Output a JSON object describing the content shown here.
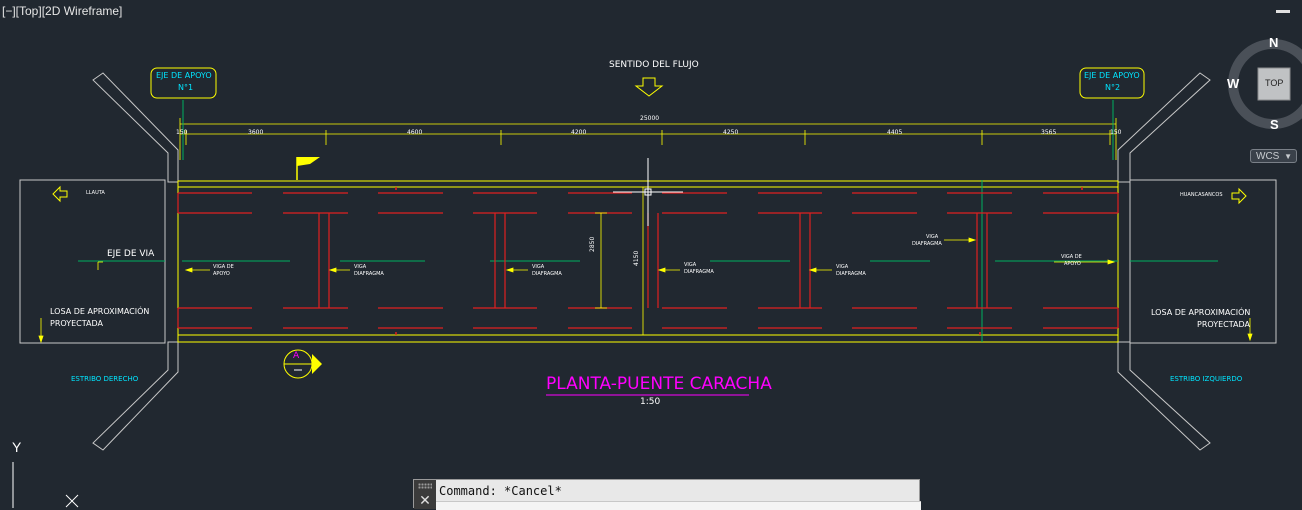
{
  "viewport": {
    "label": "[−][Top][2D Wireframe]"
  },
  "viewcube": {
    "north": "N",
    "south": "S",
    "west": "W",
    "face": "TOP",
    "wcs": "WCS"
  },
  "drawing": {
    "flow_label": "SENTIDO DEL FLUJO",
    "axis_1": {
      "line1": "EJE DE APOYO",
      "line2": "N°1"
    },
    "axis_2": {
      "line1": "EJE DE APOYO",
      "line2": "N°2"
    },
    "total_dim": "25000",
    "dims": [
      "150",
      "3600",
      "4600",
      "4200",
      "4250",
      "4405",
      "3565",
      "150"
    ],
    "left_city": "LLAUTA",
    "right_city": "HUANCASANCOS",
    "eje_via": "EJE DE VIA",
    "losa_left": {
      "line1": "LOSA DE APROXIMACIÓN",
      "line2": "PROYECTADA"
    },
    "losa_right": {
      "line1": "LOSA DE APROXIMACIÓN",
      "line2": "PROYECTADA"
    },
    "estribo_left": "ESTRIBO DERECHO",
    "estribo_right": "ESTRIBO IZQUIERDO",
    "viga_apoyo_1": {
      "line1": "VIGA DE",
      "line2": "APOYO"
    },
    "viga_apoyo_2": {
      "line1": "VIGA DE",
      "line2": "APOYO"
    },
    "diaf_1": {
      "line1": "VIGA",
      "line2": "DIAFRAGMA"
    },
    "diaf_2": {
      "line1": "VIGA",
      "line2": "DIAFRAGMA"
    },
    "diaf_3": {
      "line1": "VIGA",
      "line2": "DIAFRAGMA"
    },
    "diaf_4": {
      "line1": "VIGA",
      "line2": "DIAFRAGMA"
    },
    "diaf_5": {
      "line1": "VIGA",
      "line2": "DIAFRAGMA"
    },
    "dim_v1": "2850",
    "dim_v2": "4150",
    "section_mark": "A",
    "title": "PLANTA-PUENTE CARACHA",
    "scale": "1:50"
  },
  "ucs": {
    "y": "Y"
  },
  "command": {
    "text": "Command: *Cancel*"
  },
  "colors": {
    "background": "#212830",
    "yellow": "#ffff00",
    "red": "#e02020",
    "green": "#00b060",
    "cyan": "#00e5ff",
    "magenta": "#ff00ff"
  }
}
